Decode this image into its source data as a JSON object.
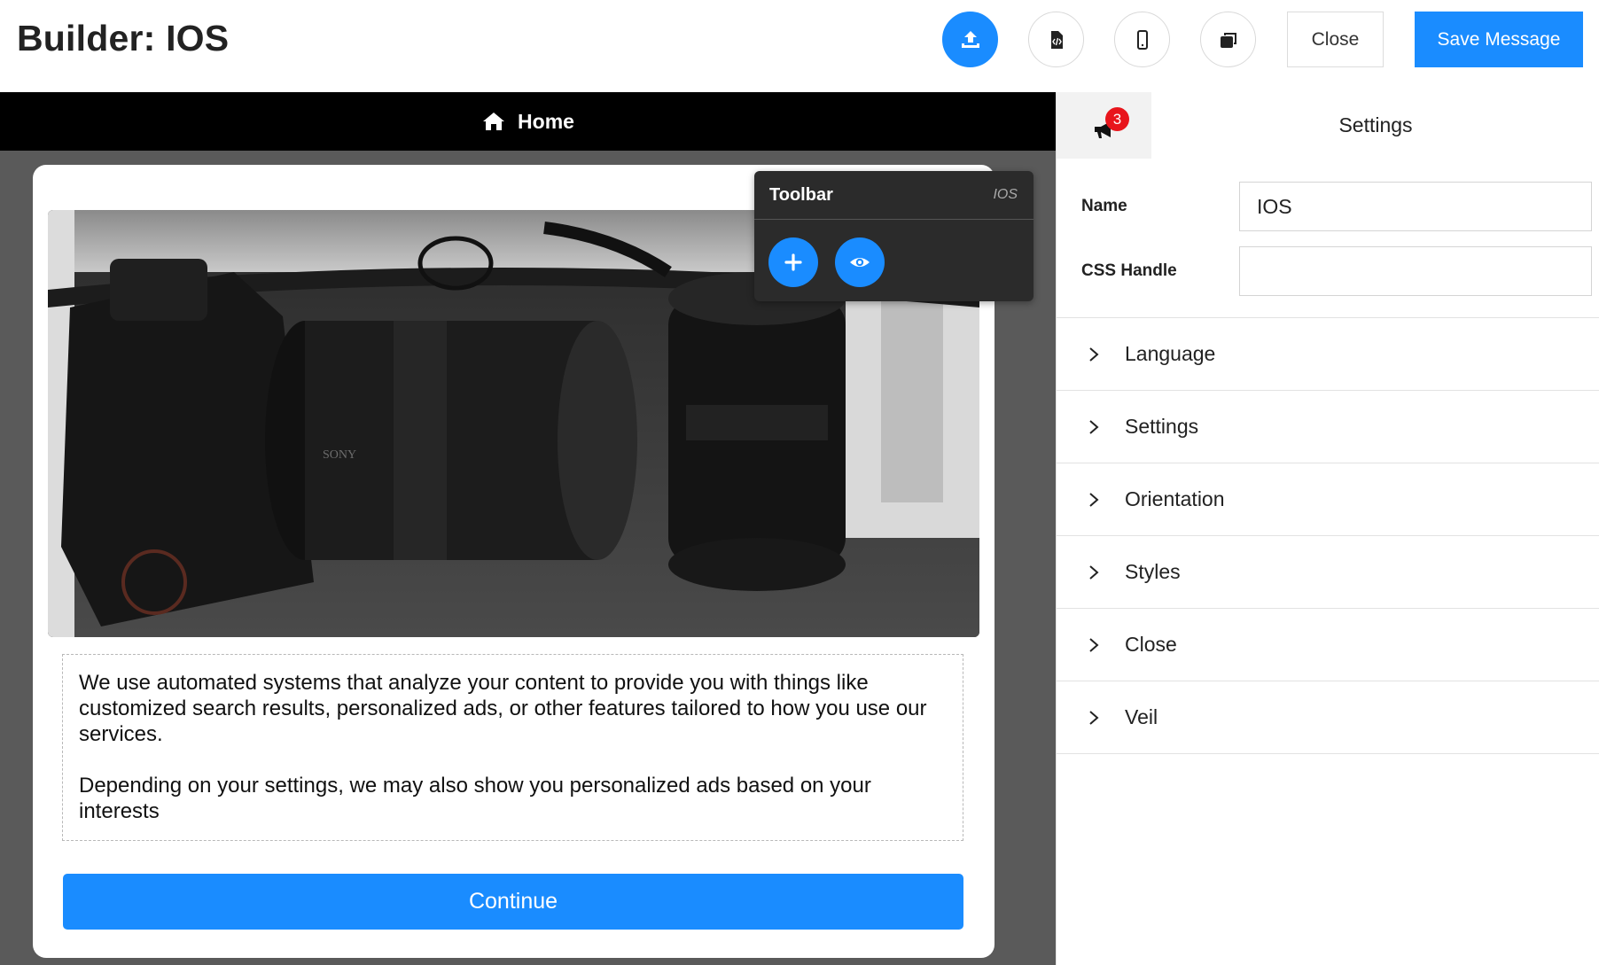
{
  "header": {
    "title": "Builder: IOS",
    "close_label": "Close",
    "save_label": "Save Message",
    "icons": [
      "upload-icon",
      "code-file-icon",
      "mobile-phone-icon",
      "copy-windows-icon"
    ]
  },
  "canvas": {
    "nav_label": "Home",
    "paragraphs": [
      "We use automated systems that analyze your content to provide you with things like customized search results, personalized ads, or other features tailored to how you use our services.",
      "Depending on your settings, we may also show you personalized ads based on your interests"
    ],
    "continue_label": "Continue"
  },
  "toolbar": {
    "title": "Toolbar",
    "tag": "IOS"
  },
  "panel": {
    "badge_count": "3",
    "heading": "Settings",
    "name_label": "Name",
    "name_value": "IOS",
    "css_label": "CSS Handle",
    "css_value": "",
    "sections": [
      "Language",
      "Settings",
      "Orientation",
      "Styles",
      "Close",
      "Veil"
    ]
  },
  "colors": {
    "accent": "#1a8cff",
    "badge": "#e8151c",
    "canvas_bg": "#5a5a5a",
    "nav_bg": "#000000",
    "toolbar_bg": "#2b2b2b"
  }
}
